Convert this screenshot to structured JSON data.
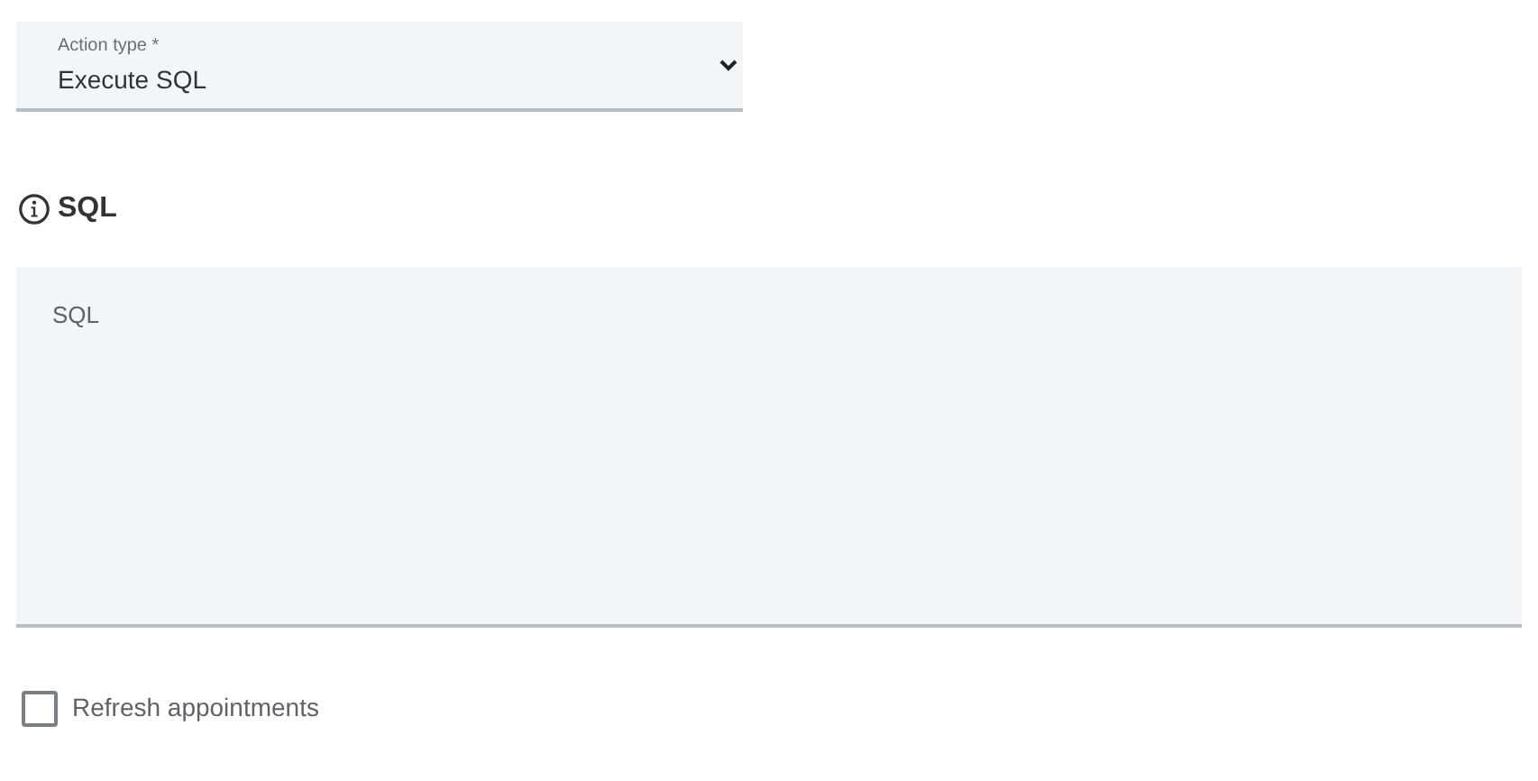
{
  "action_type": {
    "label": "Action type *",
    "value": "Execute SQL"
  },
  "sql_section": {
    "heading": "SQL"
  },
  "sql_field": {
    "placeholder": "SQL"
  },
  "refresh_checkbox": {
    "label": "Refresh appointments",
    "checked": false
  }
}
